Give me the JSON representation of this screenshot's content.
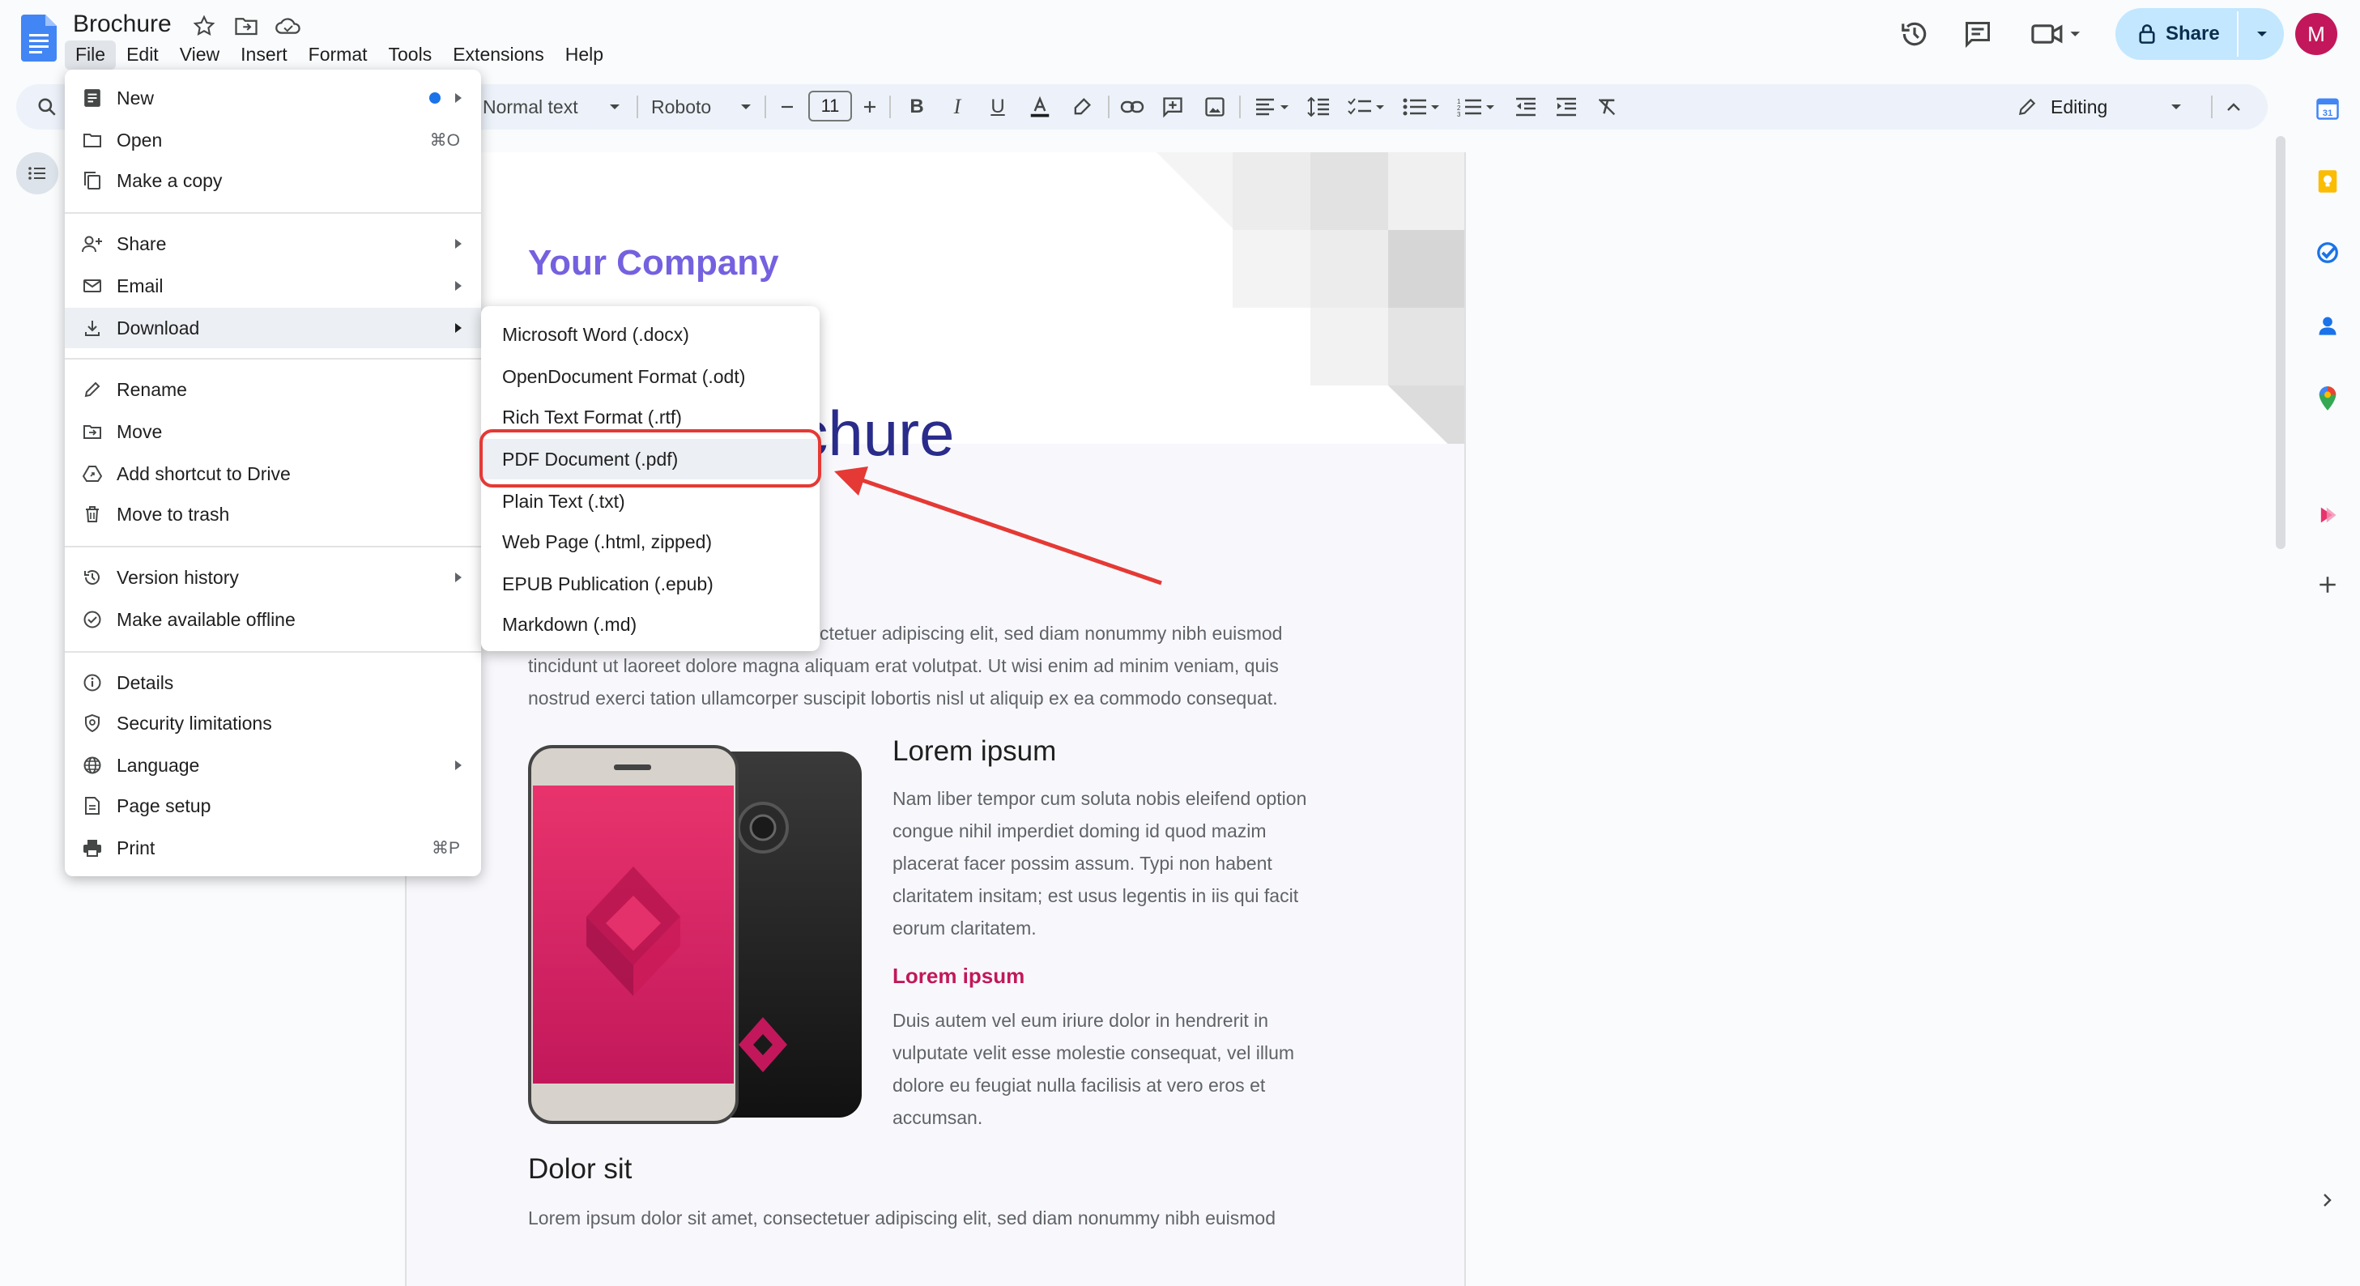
{
  "document": {
    "title": "Brochure",
    "company": "Your Company",
    "big_title": "ochure",
    "intro_text": [
      "ctetuer adipiscing elit, sed diam nonummy nibh euismod",
      "tincidunt ut laoreet dolore magna aliquam erat volutpat. Ut wisi enim ad minim veniam, quis",
      "nostrud exerci tation ullamcorper suscipit lobortis nisl ut aliquip ex ea commodo consequat."
    ],
    "section1_heading": "Lorem ipsum",
    "section1_text": [
      "Nam liber tempor cum soluta nobis eleifend option",
      "congue nihil imperdiet doming id quod mazim",
      "placerat facer possim assum. Typi non habent",
      "claritatem insitam; est usus legentis in iis qui facit",
      "eorum claritatem."
    ],
    "section2_heading": "Lorem ipsum",
    "section2_text": [
      "Duis autem vel eum iriure dolor in hendrerit in",
      "vulputate velit esse molestie consequat, vel illum",
      "dolore eu feugiat nulla facilisis at vero eros et",
      "accumsan."
    ],
    "section3_heading": "Dolor sit",
    "section3_text": "Lorem ipsum dolor sit amet, consectetuer adipiscing elit, sed diam nonummy nibh euismod"
  },
  "menubar": [
    "File",
    "Edit",
    "View",
    "Insert",
    "Format",
    "Tools",
    "Extensions",
    "Help"
  ],
  "header": {
    "share_label": "Share",
    "avatar_initial": "M"
  },
  "toolbar": {
    "style": "Normal text",
    "font": "Roboto",
    "font_size": "11",
    "mode": "Editing"
  },
  "file_menu": {
    "new": "New",
    "open": "Open",
    "open_shortcut": "⌘O",
    "make_copy": "Make a copy",
    "share": "Share",
    "email": "Email",
    "download": "Download",
    "rename": "Rename",
    "move": "Move",
    "add_shortcut": "Add shortcut to Drive",
    "move_trash": "Move to trash",
    "version_history": "Version history",
    "offline": "Make available offline",
    "details": "Details",
    "security": "Security limitations",
    "language": "Language",
    "page_setup": "Page setup",
    "print": "Print",
    "print_shortcut": "⌘P"
  },
  "download_menu": [
    "Microsoft Word (.docx)",
    "OpenDocument Format (.odt)",
    "Rich Text Format (.rtf)",
    "PDF Document (.pdf)",
    "Plain Text (.txt)",
    "Web Page (.html, zipped)",
    "EPUB Publication (.epub)",
    "Markdown (.md)"
  ],
  "colors": {
    "accent_blue": "#1a73e8",
    "share_bg": "#c2e7ff",
    "avatar_bg": "#c2185b",
    "annotation_red": "#e53935",
    "company_purple": "#7461e0",
    "pink_heading": "#c2185b"
  }
}
